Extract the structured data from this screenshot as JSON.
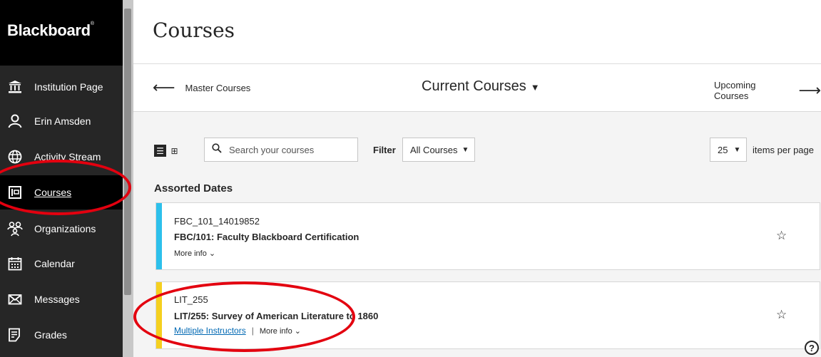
{
  "brand": {
    "logo_text": "Blackboard"
  },
  "sidebar": {
    "items": [
      {
        "label": "Institution Page",
        "icon": "institution-icon"
      },
      {
        "label": "Erin Amsden",
        "icon": "user-icon"
      },
      {
        "label": "Activity Stream",
        "icon": "globe-icon"
      },
      {
        "label": "Courses",
        "icon": "courses-icon",
        "active": true
      },
      {
        "label": "Organizations",
        "icon": "organizations-icon"
      },
      {
        "label": "Calendar",
        "icon": "calendar-icon"
      },
      {
        "label": "Messages",
        "icon": "envelope-icon"
      },
      {
        "label": "Grades",
        "icon": "grades-icon"
      }
    ]
  },
  "header": {
    "title": "Courses",
    "prev_link": "Master Courses",
    "current": "Current Courses",
    "next_link": "Upcoming Courses"
  },
  "toolbar": {
    "search_placeholder": "Search your courses",
    "filter_label": "Filter",
    "filter_value": "All Courses",
    "per_page_value": "25",
    "per_page_label": "items per page"
  },
  "section_heading": "Assorted Dates",
  "courses": [
    {
      "code": "FBC_101_14019852",
      "name": "FBC/101: Faculty Blackboard Certification",
      "instructors": "",
      "more_info": "More info",
      "color": "#2dc0eb"
    },
    {
      "code": "LIT_255",
      "name": "LIT/255: Survey of American Literature to 1860",
      "instructors": "Multiple Instructors",
      "separator": "|",
      "more_info": "More info",
      "color": "#f5d01f"
    }
  ],
  "help": {
    "label": "?"
  },
  "colors": {
    "sidebar": "#262626",
    "annotation": "#e3000f",
    "link": "#0068b3"
  }
}
